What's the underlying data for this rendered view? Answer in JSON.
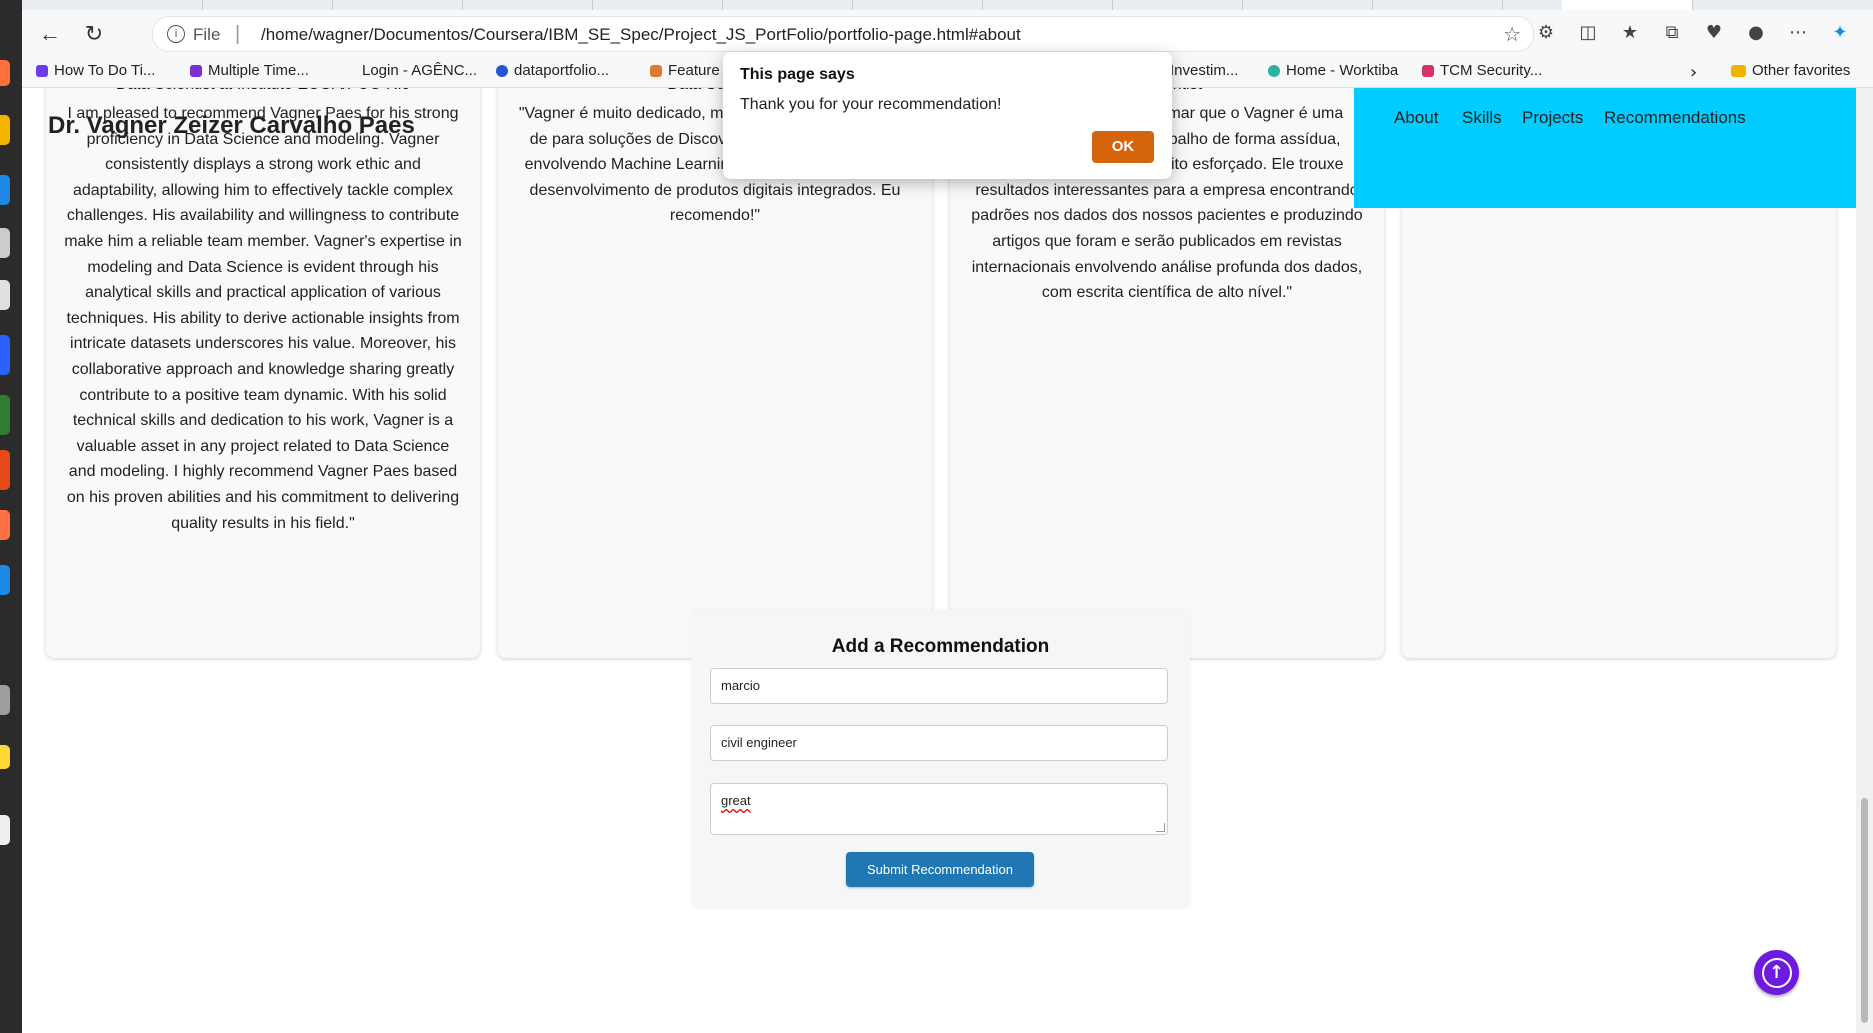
{
  "browser": {
    "scheme": "File",
    "url": "/home/wagner/Documentos/Coursera/IBM_SE_Spec/Project_JS_PortFolio/portfolio-page.html#about",
    "bookmarks": [
      {
        "label": "How To Do Ti...",
        "color": "#6a3de8"
      },
      {
        "label": "Multiple Time...",
        "color": "#7b2fd0"
      },
      {
        "label": "Login - AGÊNC...",
        "color": "#ffffff"
      },
      {
        "label": "dataportfolio...",
        "color": "#2457d6"
      },
      {
        "label": "Feature",
        "color": "#e07a2f"
      },
      {
        "label": "Investim...",
        "color": "#ffffff"
      },
      {
        "label": "Home - Worktiba",
        "color": "#2bb3a0"
      },
      {
        "label": "TCM Security...",
        "color": "#d6336c"
      },
      {
        "label": "Other favorites",
        "color": "#f0b400"
      }
    ]
  },
  "site": {
    "title": "Dr. Vagner Zeizer Carvalho Paes",
    "nav": [
      "About",
      "Skills",
      "Projects",
      "Recommendations"
    ]
  },
  "recommendations": [
    {
      "role": "Data Scientist at Instituto ECOA/PUC-Rio",
      "quote": "I am pleased to recommend Vagner Paes for his strong proficiency in Data Science and modeling. Vagner consistently displays a strong work ethic and adaptability, allowing him to effectively tackle complex challenges. His availability and willingness to contribute make him a reliable team member. Vagner's expertise in modeling and Data Science is evident through his analytical skills and practical application of various techniques. His ability to derive actionable insights from intricate datasets underscores his value. Moreover, his collaborative approach and knowledge sharing greatly contribute to a positive team dynamic. With his solid technical skills and dedication to his work, Vagner is a valuable asset in any project related to Data Science and modeling. I highly recommend Vagner Paes based on his proven abilities and his commitment to delivering quality results in his field.\""
    },
    {
      "role": "Data Science",
      "quote": "\"Vagner é muito dedicado, m coisas novas, capacidade de para soluções de Discovery, Analytics e soluções envolvendo Machine Learning. Grande potencial para desenvolvimento de produtos digitais integrados. Eu recomendo!\""
    },
    {
      "role": "r Scientist",
      "quote": "lho do Vagner na Bright rmar que o Vagner é uma pessoa que faz o seu trabalho de forma assídua, cumprindo prazos e é muito esforçado. Ele trouxe resultados interessantes para a empresa encontrando padrões nos dados dos nossos pacientes e produzindo artigos que foram e serão publicados em revistas internacionais envolvendo análise profunda dos dados, com escrita científica de alto nível.\""
    },
    {
      "role": "",
      "quote": ""
    }
  ],
  "form": {
    "heading": "Add a Recommendation",
    "name_value": "marcio",
    "role_value": "civil engineer",
    "message_value": "great",
    "submit_label": "Submit Recommendation"
  },
  "dialog": {
    "title": "This page says",
    "message": "Thank you for your recommendation!",
    "ok_label": "OK"
  },
  "colors": {
    "nav_bg": "#00ccff",
    "submit_bg": "#1f78b4",
    "ok_bg": "#d4650c",
    "to_top_bg": "#6e1ae0"
  }
}
